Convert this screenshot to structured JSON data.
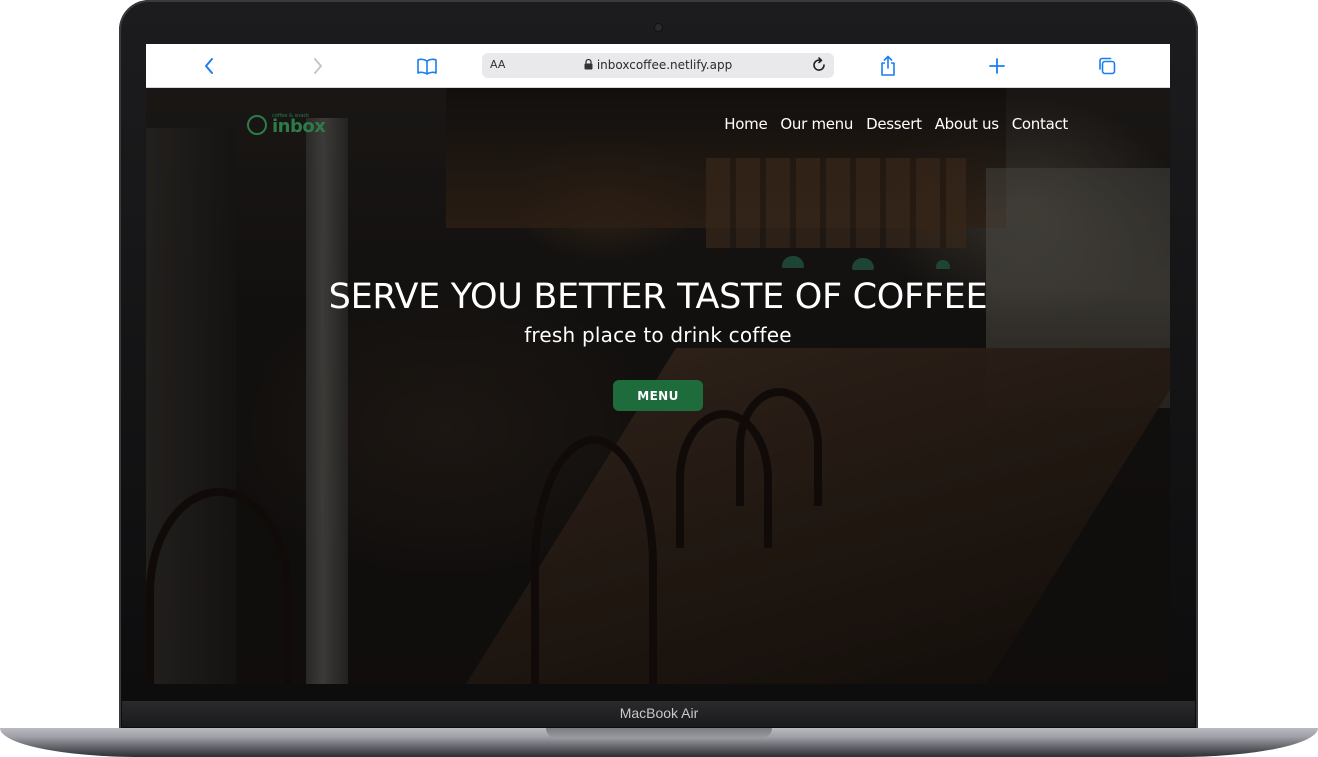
{
  "device": {
    "label": "MacBook Air"
  },
  "browser": {
    "text_size_label": "AA",
    "url": "inboxcoffee.netlify.app",
    "icons": [
      "back-chevron-icon",
      "forward-chevron-icon",
      "bookmarks-book-icon",
      "lock-icon",
      "reload-icon",
      "share-icon",
      "new-tab-plus-icon",
      "tabs-icon"
    ]
  },
  "site": {
    "logo": {
      "small_text": "coffee & snack",
      "word": "inbox"
    },
    "nav": [
      "Home",
      "Our menu",
      "Dessert",
      "About us",
      "Contact"
    ],
    "hero": {
      "title": "SERVE YOU BETTER TASTE OF COFFEE",
      "subtitle": "fresh place to drink coffee",
      "button": "MENU"
    },
    "colors": {
      "accent": "#1e6b3c",
      "logo": "#2d7a4a"
    }
  }
}
